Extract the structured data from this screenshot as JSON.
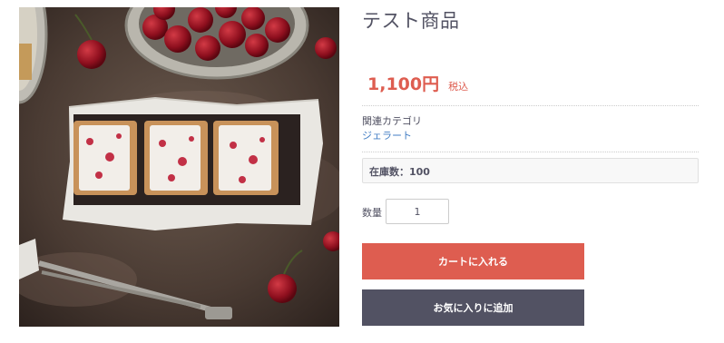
{
  "product": {
    "name": "テスト商品",
    "price": "1,100円",
    "tax_label": "税込"
  },
  "category": {
    "heading": "関連カテゴリ",
    "link": "ジェラート"
  },
  "stock": {
    "text": "在庫数：100"
  },
  "quantity": {
    "label": "数量",
    "value": "1"
  },
  "buttons": {
    "add_to_cart": "カートに入れる",
    "add_to_favorites": "お気に入りに追加"
  },
  "colors": {
    "accent": "#de5d50",
    "dark_button": "#525263",
    "link": "#437ec4"
  }
}
